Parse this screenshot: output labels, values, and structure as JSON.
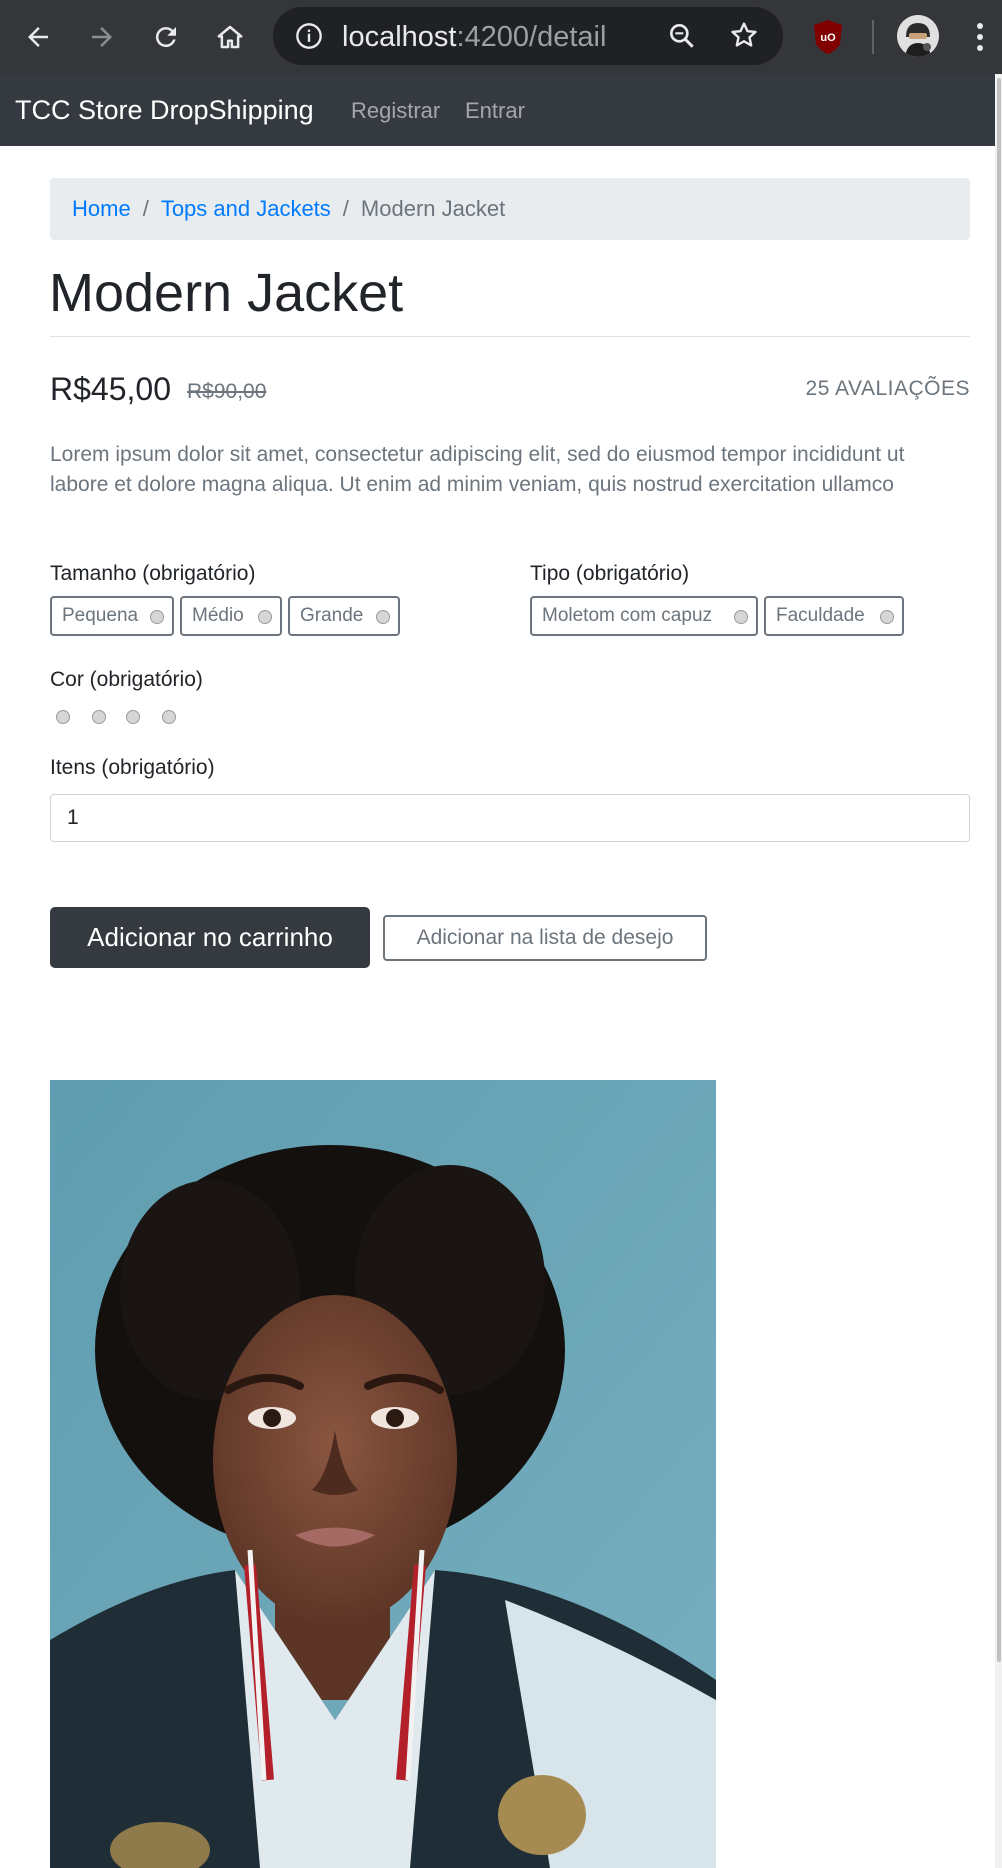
{
  "browser": {
    "url_host": "localhost",
    "url_rest": ":4200/detail",
    "icons": [
      "back-icon",
      "forward-icon",
      "reload-icon",
      "home-icon",
      "info-icon",
      "zoom-icon",
      "star-icon",
      "ublock-icon",
      "profile-avatar",
      "more-icon"
    ]
  },
  "navbar": {
    "brand": "TCC Store DropShipping",
    "links": [
      "Registrar",
      "Entrar"
    ]
  },
  "breadcrumb": {
    "items": [
      "Home",
      "Tops and Jackets"
    ],
    "active": "Modern Jacket"
  },
  "product": {
    "title": "Modern Jacket",
    "price": "R$45,00",
    "old_price": "R$90,00",
    "reviews": "25 AVALIAÇÕES",
    "description": "Lorem ipsum dolor sit amet, consectetur adipiscing elit, sed do eiusmod tempor incididunt ut labore et dolore magna aliqua. Ut enim ad minim veniam, quis nostrud exercitation ullamco"
  },
  "size": {
    "label": "Tamanho (obrigatório)",
    "options": [
      "Pequena",
      "Médio",
      "Grande"
    ]
  },
  "type": {
    "label": "Tipo (obrigatório)",
    "options": [
      "Moletom com capuz",
      "Faculdade"
    ]
  },
  "color": {
    "label": "Cor (obrigatório)",
    "options_count": 4
  },
  "items": {
    "label": "Itens (obrigatório)",
    "value": "1"
  },
  "actions": {
    "add_to_cart": "Adicionar no carrinho",
    "add_to_wishlist": "Adicionar na lista de desejo"
  },
  "colors": {
    "navbar": "#343a40",
    "link": "#007bff",
    "muted": "#6c757d",
    "photo_bg": "#6aa4b6"
  }
}
